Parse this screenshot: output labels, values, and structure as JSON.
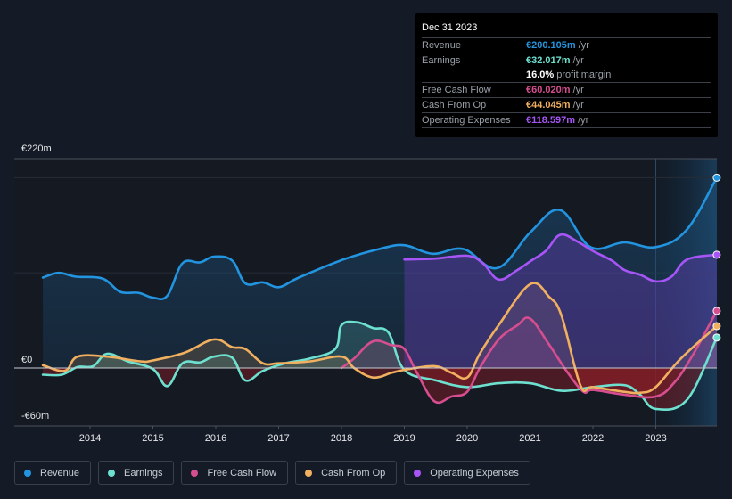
{
  "tooltip": {
    "date": "Dec 31 2023",
    "rows": [
      {
        "label": "Revenue",
        "value": "€200.105m",
        "unit": "/yr",
        "color": "#2394df"
      },
      {
        "label": "Earnings",
        "value": "€32.017m",
        "unit": "/yr",
        "color": "#6de0cf"
      },
      {
        "label": "",
        "value": "16.0%",
        "unit": "profit margin",
        "color": "#ffffff"
      },
      {
        "label": "Free Cash Flow",
        "value": "€60.020m",
        "unit": "/yr",
        "color": "#d64e8f"
      },
      {
        "label": "Cash From Op",
        "value": "€44.045m",
        "unit": "/yr",
        "color": "#f0b060"
      },
      {
        "label": "Operating Expenses",
        "value": "€118.597m",
        "unit": "/yr",
        "color": "#a855f7"
      }
    ]
  },
  "legend": [
    {
      "label": "Revenue",
      "color": "#2394df"
    },
    {
      "label": "Earnings",
      "color": "#6de0cf"
    },
    {
      "label": "Free Cash Flow",
      "color": "#d64e8f"
    },
    {
      "label": "Cash From Op",
      "color": "#f0b060"
    },
    {
      "label": "Operating Expenses",
      "color": "#a855f7"
    }
  ],
  "chart_data": {
    "type": "line",
    "title": "",
    "xlabel": "",
    "ylabel": "",
    "y_tick_labels": [
      "€220m",
      "€0",
      "-€60m"
    ],
    "y_ticks": [
      220,
      0,
      -60
    ],
    "ylim": [
      -60,
      220
    ],
    "xlim": [
      2013.25,
      2023.97
    ],
    "x_tick_labels": [
      "2014",
      "2015",
      "2016",
      "2017",
      "2018",
      "2019",
      "2020",
      "2021",
      "2022",
      "2023"
    ],
    "x_ticks": [
      2014,
      2015,
      2016,
      2017,
      2018,
      2019,
      2020,
      2021,
      2022,
      2023
    ],
    "gridlines_y": [
      200,
      100
    ],
    "highlight_from": 2023.0,
    "legend_position": "bottom",
    "series": [
      {
        "name": "Revenue",
        "color": "#2394df",
        "x": [
          2013.25,
          2013.5,
          2013.78,
          2014.2,
          2014.48,
          2014.77,
          2015.0,
          2015.23,
          2015.47,
          2015.75,
          2015.97,
          2016.26,
          2016.47,
          2016.75,
          2017.01,
          2017.32,
          2018.03,
          2018.6,
          2019.0,
          2019.45,
          2019.94,
          2020.48,
          2021.01,
          2021.48,
          2021.96,
          2022.5,
          2023.0,
          2023.49,
          2023.97
        ],
        "values": [
          95,
          100,
          96,
          94,
          80,
          79,
          74,
          76,
          110,
          111,
          117,
          113,
          89,
          90,
          85,
          95,
          114,
          125,
          129,
          120,
          125,
          105,
          143,
          166,
          127,
          132,
          127,
          145,
          200
        ]
      },
      {
        "name": "Earnings",
        "color": "#6de0cf",
        "x": [
          2013.25,
          2013.55,
          2013.8,
          2014.05,
          2014.27,
          2014.6,
          2015.0,
          2015.23,
          2015.47,
          2015.75,
          2015.97,
          2016.26,
          2016.47,
          2016.75,
          2017.1,
          2017.5,
          2017.9,
          2018.0,
          2018.25,
          2018.5,
          2018.75,
          2019.0,
          2019.5,
          2020.0,
          2020.5,
          2021.0,
          2021.5,
          2022.0,
          2022.5,
          2022.75,
          2023.0,
          2023.5,
          2023.97
        ],
        "values": [
          -7,
          -7,
          1,
          2,
          15,
          7,
          -1,
          -19,
          5,
          6,
          12,
          11,
          -13,
          -3,
          5,
          10,
          20,
          45,
          48,
          42,
          37,
          -2,
          -13,
          -20,
          -16,
          -16,
          -24,
          -20,
          -18,
          -28,
          -43,
          -33,
          32
        ]
      },
      {
        "name": "Free Cash Flow",
        "color": "#d64e8f",
        "x": [
          2018.0,
          2018.2,
          2018.5,
          2018.8,
          2019.0,
          2019.2,
          2019.48,
          2019.75,
          2020.0,
          2020.2,
          2020.5,
          2020.8,
          2021.0,
          2021.3,
          2021.6,
          2021.85,
          2022.0,
          2022.5,
          2023.0,
          2023.3,
          2023.6,
          2023.97
        ],
        "values": [
          0,
          10,
          28,
          24,
          20,
          -5,
          -35,
          -30,
          -25,
          0,
          30,
          45,
          52,
          25,
          -5,
          -25,
          -23,
          -28,
          -30,
          -15,
          15,
          60
        ]
      },
      {
        "name": "Cash From Op",
        "color": "#f0b060",
        "x": [
          2013.25,
          2013.6,
          2013.8,
          2014.27,
          2014.8,
          2015.0,
          2015.5,
          2015.97,
          2016.26,
          2016.47,
          2016.75,
          2017.0,
          2017.5,
          2018.0,
          2018.2,
          2018.5,
          2018.8,
          2019.0,
          2019.48,
          2019.75,
          2020.0,
          2020.2,
          2020.5,
          2021.0,
          2021.3,
          2021.5,
          2021.8,
          2022.0,
          2022.5,
          2022.75,
          2023.0,
          2023.4,
          2023.97
        ],
        "values": [
          3,
          -3,
          12,
          12,
          7,
          8,
          16,
          30,
          22,
          20,
          5,
          5,
          7,
          12,
          0,
          -10,
          -5,
          -2,
          2,
          -5,
          -10,
          15,
          45,
          88,
          75,
          55,
          -18,
          -20,
          -25,
          -26,
          -20,
          10,
          44
        ]
      },
      {
        "name": "Operating Expenses",
        "color": "#a855f7",
        "x": [
          2019.0,
          2019.5,
          2020.0,
          2020.25,
          2020.5,
          2020.8,
          2021.0,
          2021.25,
          2021.48,
          2021.75,
          2022.0,
          2022.3,
          2022.5,
          2022.75,
          2023.0,
          2023.25,
          2023.5,
          2023.97
        ],
        "values": [
          114,
          115,
          118,
          110,
          93,
          103,
          112,
          123,
          140,
          133,
          123,
          113,
          103,
          98,
          91,
          96,
          114,
          119
        ]
      }
    ]
  }
}
